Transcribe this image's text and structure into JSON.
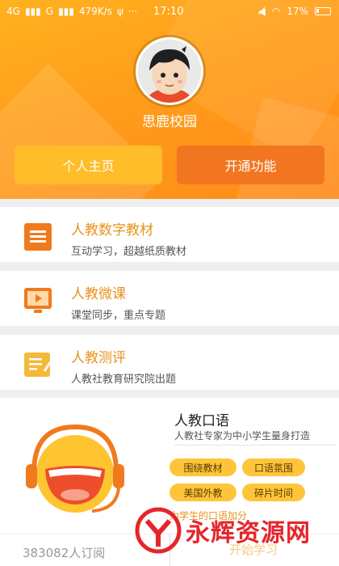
{
  "status_bar": {
    "left": [
      "4G",
      "G",
      "479K/s"
    ],
    "time": "17:10",
    "battery": "17%"
  },
  "profile": {
    "username": "思鹿校园",
    "home_button": "个人主页",
    "open_button": "开通功能"
  },
  "services": [
    {
      "title": "人教数字教材",
      "subtitle": "互动学习，超越纸质教材",
      "icon": "book-list-icon"
    },
    {
      "title": "人教微课",
      "subtitle": "课堂同步，重点专题",
      "icon": "video-play-icon"
    },
    {
      "title": "人教测评",
      "subtitle": "人教社教育研究院出题",
      "icon": "edit-paper-icon"
    }
  ],
  "oral": {
    "title": "人教口语",
    "subtitle": "人教社专家为中小学生量身打造",
    "tags": [
      "围绕教材",
      "口语氛围",
      "美国外教",
      "碎片时间"
    ],
    "note": "为学生的口语加分"
  },
  "footer": {
    "subscribers": "383082人订阅",
    "start": "开始学习"
  },
  "watermark": {
    "text": "永辉资源网"
  },
  "colors": {
    "header": "#ff9d1a",
    "accent": "#e8921c",
    "button_primary": "#ffbd2a",
    "button_secondary": "#f2751f",
    "tag": "#ffc53a"
  }
}
